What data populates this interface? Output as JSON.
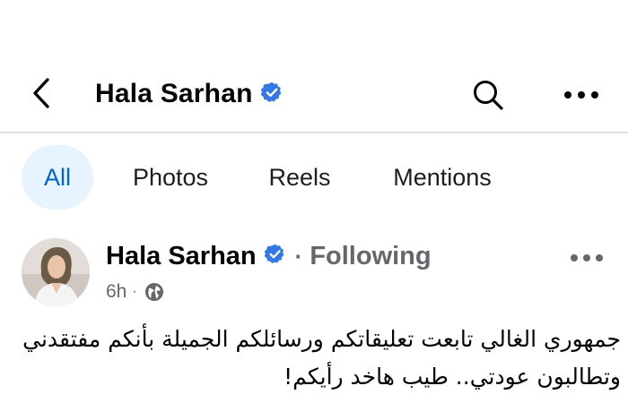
{
  "header": {
    "title": "Hala Sarhan",
    "back_icon": "chevron-left-icon",
    "search_icon": "search-icon",
    "more_icon": "more-horizontal-icon",
    "verified_icon": "verified-badge-icon",
    "verified_color": "#3578e5"
  },
  "tabs": [
    {
      "label": "All",
      "active": true
    },
    {
      "label": "Photos",
      "active": false
    },
    {
      "label": "Reels",
      "active": false
    },
    {
      "label": "Mentions",
      "active": false
    }
  ],
  "post": {
    "author": "Hala Sarhan",
    "separator": "·",
    "follow_status": "Following",
    "time": "6h",
    "meta_separator": "·",
    "privacy_icon": "globe-icon",
    "text": "جمهوري الغالي تابعت تعليقاتكم ورسائلكم الجميلة بأنكم مفتقدني وتطالبون عودتي.. طيب هاخد رأيكم!"
  },
  "colors": {
    "accent": "#0064d1",
    "active_tab_bg": "#e7f3ff",
    "secondary_text": "#65676b",
    "divider": "#dfe1e5"
  }
}
